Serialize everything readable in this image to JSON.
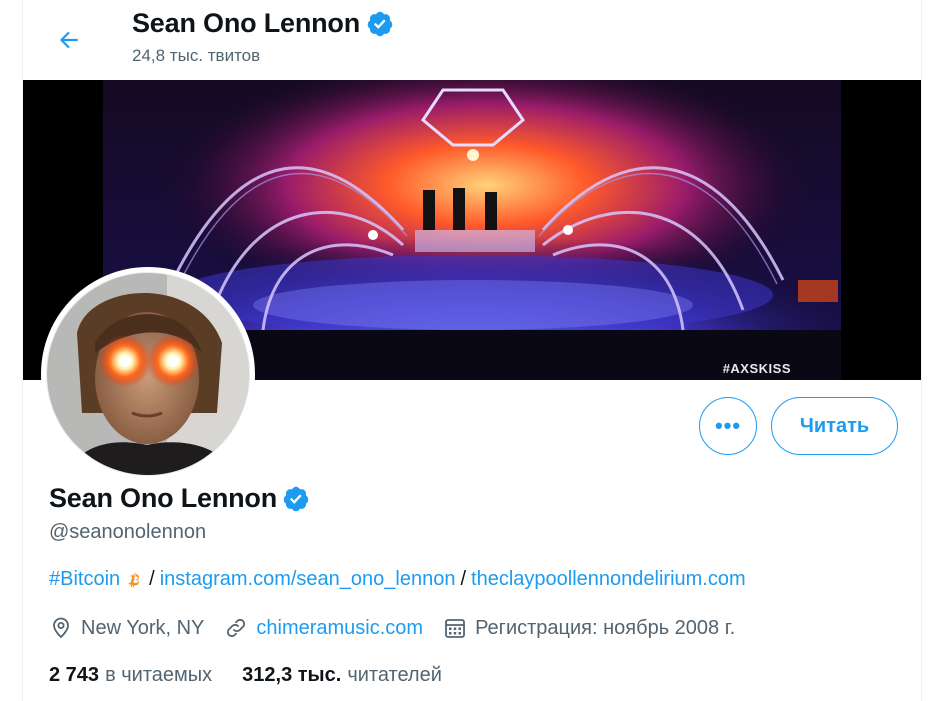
{
  "header": {
    "title": "Sean Ono Lennon",
    "tweet_count": "24,8 тыс. твитов"
  },
  "banner": {
    "tag": "#AXSKISS"
  },
  "actions": {
    "more_label": "•••",
    "follow_label": "Читать"
  },
  "profile": {
    "name": "Sean Ono Lennon",
    "handle": "@seanonolennon",
    "verified": true,
    "bio": {
      "hashtag": "#Bitcoin",
      "sep1": "/",
      "link1": "instagram.com/sean_ono_lennon",
      "sep2": "/",
      "link2": "theclaypoollennondelirium.com"
    },
    "location": "New York, NY",
    "website": "chimeramusic.com",
    "joined": "Регистрация: ноябрь 2008 г."
  },
  "stats": {
    "following_count": "2 743",
    "following_label": "в читаемых",
    "followers_count": "312,3 тыс.",
    "followers_label": "читателей"
  },
  "colors": {
    "accent": "#1d9bf0",
    "text": "#0f1419",
    "secondary": "#536471",
    "bitcoin": "#f7931a"
  },
  "icons": [
    "back-arrow-icon",
    "verified-badge-icon",
    "bitcoin-icon",
    "location-icon",
    "link-icon",
    "calendar-icon"
  ]
}
